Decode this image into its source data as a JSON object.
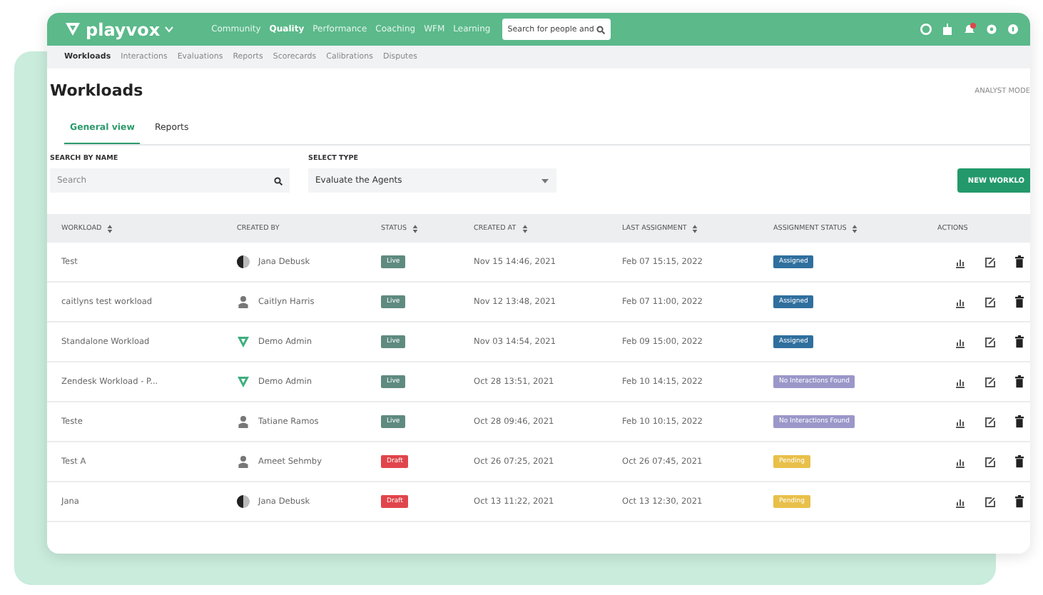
{
  "app": {
    "logo": "playvox",
    "search": {
      "placeholder": "Search for people and"
    },
    "nav": [
      {
        "label": "Community",
        "selected": false
      },
      {
        "label": "Quality",
        "selected": true
      },
      {
        "label": "Performance",
        "selected": false
      },
      {
        "label": "Coaching",
        "selected": false
      },
      {
        "label": "WFM",
        "selected": false
      },
      {
        "label": "Learning",
        "selected": false
      }
    ]
  },
  "subnav": [
    {
      "label": "Workloads",
      "selected": true
    },
    {
      "label": "Interactions",
      "selected": false
    },
    {
      "label": "Evaluations",
      "selected": false
    },
    {
      "label": "Reports",
      "selected": false
    },
    {
      "label": "Scorecards",
      "selected": false
    },
    {
      "label": "Calibrations",
      "selected": false
    },
    {
      "label": "Disputes",
      "selected": false
    }
  ],
  "page": {
    "title": "Workloads",
    "mode": "ANALYST MODE"
  },
  "tabs": [
    {
      "label": "General view",
      "selected": true
    },
    {
      "label": "Reports",
      "selected": false
    }
  ],
  "filters": {
    "search": {
      "label": "SEARCH BY NAME",
      "placeholder": "Search"
    },
    "type": {
      "label": "SELECT TYPE",
      "value": "Evaluate the Agents"
    }
  },
  "new_button": "NEW WORKLO",
  "table": {
    "columns": [
      {
        "label": "WORKLOAD",
        "sortable": true
      },
      {
        "label": "CREATED BY",
        "sortable": false
      },
      {
        "label": "STATUS",
        "sortable": true
      },
      {
        "label": "CREATED AT",
        "sortable": true
      },
      {
        "label": "LAST ASSIGNMENT",
        "sortable": true
      },
      {
        "label": "ASSIGNMENT STATUS",
        "sortable": true
      },
      {
        "label": "ACTIONS",
        "sortable": false
      }
    ],
    "rows": [
      {
        "workload": "Test",
        "created_by": {
          "name": "Jana Debusk",
          "kind": "photo"
        },
        "status": {
          "label": "Live",
          "color": "#5f8a80"
        },
        "created_at": "Nov 15 14:46, 2021",
        "last_assignment": "Feb 07 15:15, 2022",
        "assignment_status": {
          "label": "Assigned",
          "color": "#2f6f9e"
        }
      },
      {
        "workload": "caitlyns test workload",
        "created_by": {
          "name": "Caitlyn Harris",
          "kind": "person"
        },
        "status": {
          "label": "Live",
          "color": "#5f8a80"
        },
        "created_at": "Nov 12 13:48, 2021",
        "last_assignment": "Feb 07 11:00, 2022",
        "assignment_status": {
          "label": "Assigned",
          "color": "#2f6f9e"
        }
      },
      {
        "workload": "Standalone Workload",
        "created_by": {
          "name": "Demo Admin",
          "kind": "logo"
        },
        "status": {
          "label": "Live",
          "color": "#5f8a80"
        },
        "created_at": "Nov 03 14:54, 2021",
        "last_assignment": "Feb 09 15:00, 2022",
        "assignment_status": {
          "label": "Assigned",
          "color": "#2f6f9e"
        }
      },
      {
        "workload": "Zendesk Workload - P...",
        "created_by": {
          "name": "Demo Admin",
          "kind": "logo"
        },
        "status": {
          "label": "Live",
          "color": "#5f8a80"
        },
        "created_at": "Oct 28 13:51, 2021",
        "last_assignment": "Feb 10 14:15, 2022",
        "assignment_status": {
          "label": "No Interactions Found",
          "color": "#9b97c9"
        }
      },
      {
        "workload": "Teste",
        "created_by": {
          "name": "Tatiane Ramos",
          "kind": "person"
        },
        "status": {
          "label": "Live",
          "color": "#5f8a80"
        },
        "created_at": "Oct 28 09:46, 2021",
        "last_assignment": "Feb 10 10:15, 2022",
        "assignment_status": {
          "label": "No Interactions Found",
          "color": "#9b97c9"
        }
      },
      {
        "workload": "Test A",
        "created_by": {
          "name": "Ameet Sehmby",
          "kind": "person"
        },
        "status": {
          "label": "Draft",
          "color": "#e0454b"
        },
        "created_at": "Oct 26 07:25, 2021",
        "last_assignment": "Oct 26 07:45, 2021",
        "assignment_status": {
          "label": "Pending",
          "color": "#e8c04a"
        }
      },
      {
        "workload": "Jana",
        "created_by": {
          "name": "Jana Debusk",
          "kind": "photo"
        },
        "status": {
          "label": "Draft",
          "color": "#e0454b"
        },
        "created_at": "Oct 13 11:22, 2021",
        "last_assignment": "Oct 13 12:30, 2021",
        "assignment_status": {
          "label": "Pending",
          "color": "#e8c04a"
        }
      }
    ]
  }
}
